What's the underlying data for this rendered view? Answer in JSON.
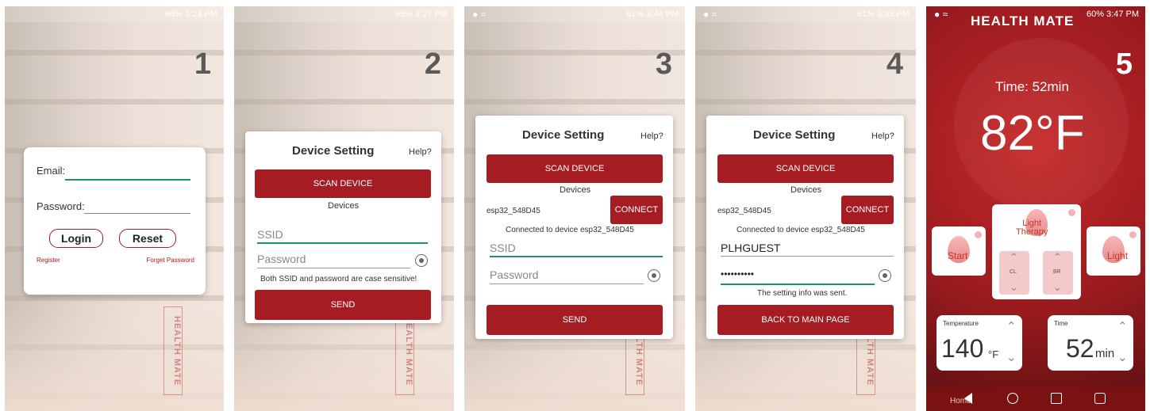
{
  "panels": [
    {
      "status": "66% 3:23 PM",
      "step": "1",
      "email_label": "Email:",
      "password_label": "Password:",
      "login": "Login",
      "reset": "Reset",
      "register": "Register",
      "forget": "Forget Password"
    },
    {
      "status": "65% 3:27 PM",
      "step": "2",
      "title": "Device Setting",
      "help": "Help?",
      "scan": "SCAN DEVICE",
      "devices": "Devices",
      "ssid_placeholder": "SSID",
      "password_placeholder": "Password",
      "note": "Both SSID and password are case sensitive!",
      "send": "SEND"
    },
    {
      "status": "61% 3:44 PM",
      "step": "3",
      "title": "Device Setting",
      "help": "Help?",
      "scan": "SCAN DEVICE",
      "devices": "Devices",
      "device_name": "esp32_548D45",
      "connect": "CONNECT",
      "connected": "Connected to device esp32_548D45",
      "ssid_placeholder": "SSID",
      "password_placeholder": "Password",
      "send": "SEND"
    },
    {
      "status": "61% 3:45 PM",
      "step": "4",
      "title": "Device Setting",
      "help": "Help?",
      "scan": "SCAN DEVICE",
      "devices": "Devices",
      "device_name": "esp32_548D45",
      "connect": "CONNECT",
      "connected": "Connected to device esp32_548D45",
      "ssid_value": "PLHGUEST",
      "password_value": "••••••••••",
      "sent": "The setting info was sent.",
      "back": "BACK TO MAIN PAGE"
    },
    {
      "status": "60% 3:47 PM",
      "step": "5",
      "brand": "HEALTH MATE",
      "time": "Time: 52min",
      "temp_big": "82°F",
      "light_therapy": "Light\nTherapy",
      "start": "Start",
      "light": "Light",
      "cl": "CL",
      "br": "BR",
      "temperature_label": "Temperature",
      "temperature_value": "140",
      "temperature_unit": "°F",
      "time_label": "Time",
      "time_value": "52",
      "time_unit": "min",
      "home": "Home"
    }
  ],
  "hm_badge": "HEALTH MATE",
  "colors": {
    "brand_red": "#a51c22",
    "teal": "#1e8f7c"
  }
}
